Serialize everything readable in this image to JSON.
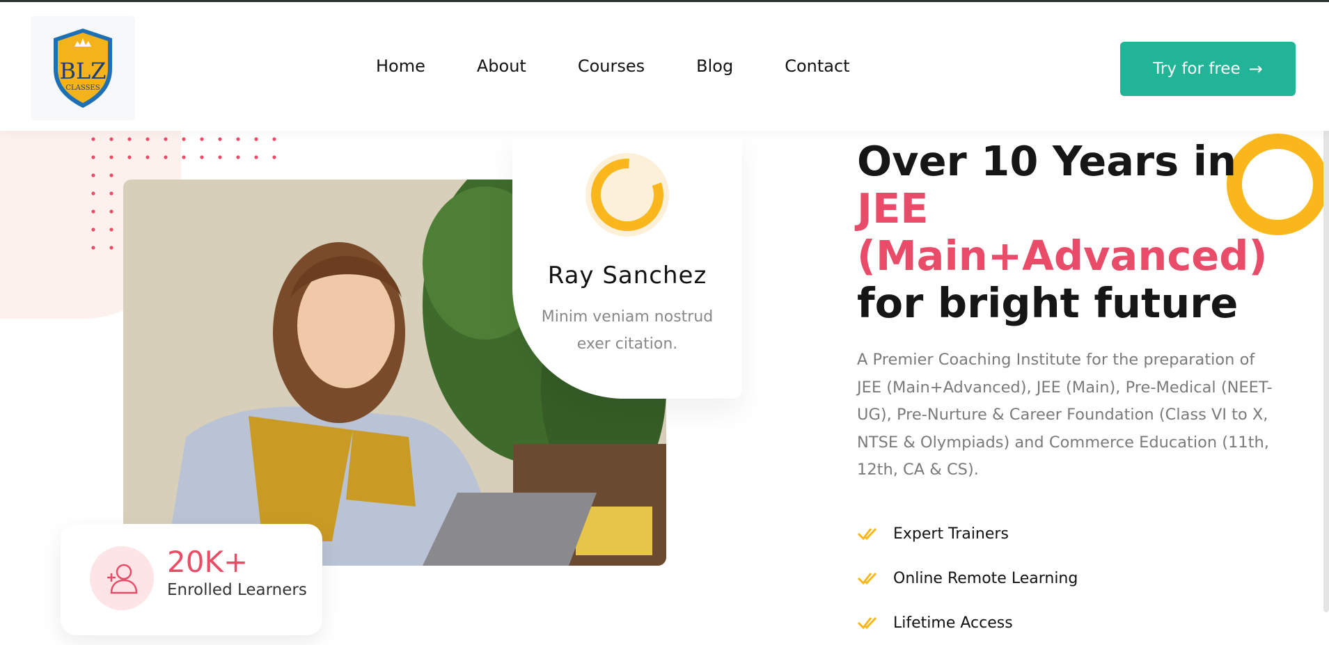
{
  "header": {
    "logo": {
      "text": "BLZ",
      "subtext": "CLASSES",
      "icon": "crown-shield-logo"
    },
    "nav": [
      "Home",
      "About",
      "Courses",
      "Blog",
      "Contact"
    ],
    "cta_label": "Try for free",
    "cta_icon": "arrow-right-icon"
  },
  "colors": {
    "accent_teal": "#21b496",
    "accent_pink": "#e94c68",
    "accent_yellow": "#f9b71c"
  },
  "profile_card": {
    "name": "Ray Sanchez",
    "description": "Minim veniam nostrud exer citation."
  },
  "stat": {
    "value": "20K+",
    "label": "Enrolled Learners",
    "icon": "user-add-icon"
  },
  "hero": {
    "title_line1": "Over 10 Years in",
    "title_accent1": "JEE",
    "title_accent2": "(Main+Advanced)",
    "title_line2": "for bright future",
    "description": "A Premier Coaching Institute for the preparation of JEE (Main+Advanced), JEE (Main), Pre-Medical (NEET-UG), Pre-Nurture & Career Foundation (Class VI to X, NTSE & Olympiads) and Commerce Education (11th, 12th, CA & CS).",
    "features": [
      "Expert Trainers",
      "Online Remote Learning",
      "Lifetime Access"
    ]
  }
}
